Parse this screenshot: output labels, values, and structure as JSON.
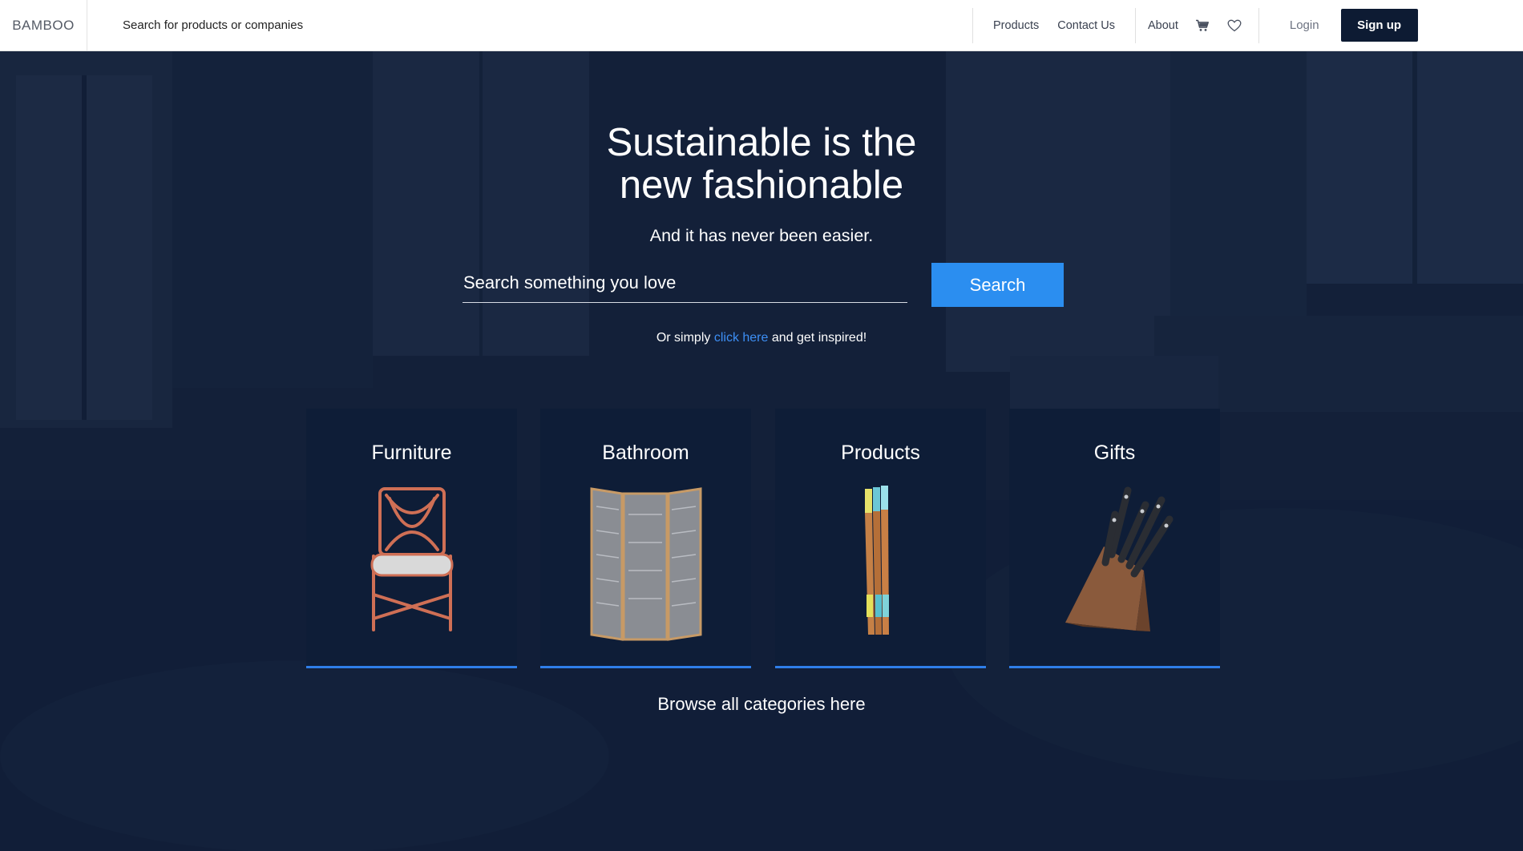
{
  "header": {
    "brand": "BAMBOO",
    "search_placeholder": "Search for products or companies",
    "nav": [
      "Products",
      "Contact Us",
      "About"
    ],
    "login": "Login",
    "signup": "Sign up"
  },
  "hero": {
    "title": "Sustainable is the new fashionable",
    "subtitle": "And it has never been easier.",
    "search_placeholder": "Search something you love",
    "search_button": "Search",
    "inspire_prefix": "Or simply",
    "inspire_link": "click here",
    "inspire_suffix": "and get inspired!"
  },
  "categories": [
    {
      "title": "Furniture"
    },
    {
      "title": "Bathroom"
    },
    {
      "title": "Products"
    },
    {
      "title": "Gifts"
    }
  ],
  "browse": "Browse all categories here",
  "colors": {
    "navy": "#0d1b33",
    "accent_blue": "#2b8ef0",
    "link_blue": "#3d8ff5",
    "card_border": "#2f7ee8"
  },
  "icons": [
    "cart-icon",
    "heart-icon"
  ]
}
